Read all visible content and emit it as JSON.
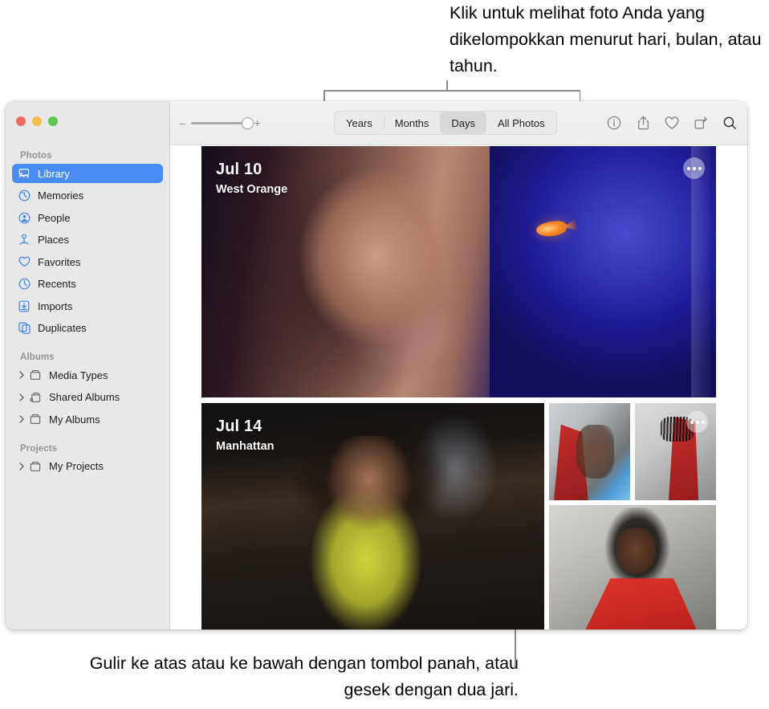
{
  "callouts": {
    "top": "Klik untuk melihat foto Anda yang dikelompokkan menurut hari, bulan, atau tahun.",
    "bottom": "Gulir ke atas atau ke bawah dengan tombol panah, atau gesek dengan dua jari."
  },
  "window": {
    "traffic_lights": {
      "close": "close-button",
      "minimize": "minimize-button",
      "zoom": "zoom-button"
    }
  },
  "sidebar": {
    "sections": [
      {
        "title": "Photos",
        "items": [
          {
            "label": "Library",
            "icon": "library-icon",
            "selected": true,
            "group": false
          },
          {
            "label": "Memories",
            "icon": "memories-icon",
            "selected": false,
            "group": false
          },
          {
            "label": "People",
            "icon": "people-icon",
            "selected": false,
            "group": false
          },
          {
            "label": "Places",
            "icon": "places-icon",
            "selected": false,
            "group": false
          },
          {
            "label": "Favorites",
            "icon": "heart-icon",
            "selected": false,
            "group": false
          },
          {
            "label": "Recents",
            "icon": "clock-icon",
            "selected": false,
            "group": false
          },
          {
            "label": "Imports",
            "icon": "import-icon",
            "selected": false,
            "group": false
          },
          {
            "label": "Duplicates",
            "icon": "duplicates-icon",
            "selected": false,
            "group": false
          }
        ]
      },
      {
        "title": "Albums",
        "items": [
          {
            "label": "Media Types",
            "icon": "album-icon",
            "selected": false,
            "group": true
          },
          {
            "label": "Shared Albums",
            "icon": "shared-album-icon",
            "selected": false,
            "group": true
          },
          {
            "label": "My Albums",
            "icon": "album-icon",
            "selected": false,
            "group": true
          }
        ]
      },
      {
        "title": "Projects",
        "items": [
          {
            "label": "My Projects",
            "icon": "album-icon",
            "selected": false,
            "group": true
          }
        ]
      }
    ]
  },
  "toolbar": {
    "zoom_slider": {
      "decrease_label": "–",
      "increase_label": "+",
      "value": 100
    },
    "segmented": {
      "options": [
        "Years",
        "Months",
        "Days",
        "All Photos"
      ],
      "selected": "Days"
    },
    "icons": [
      {
        "name": "info-icon",
        "label": "Info"
      },
      {
        "name": "share-icon",
        "label": "Share"
      },
      {
        "name": "favorite-icon",
        "label": "Favorite"
      },
      {
        "name": "rotate-icon",
        "label": "Rotate"
      },
      {
        "name": "search-icon",
        "label": "Search"
      }
    ]
  },
  "library": {
    "days": [
      {
        "date": "Jul 10",
        "place": "West Orange",
        "more_button": "more-options-button"
      },
      {
        "date": "Jul 14",
        "place": "Manhattan",
        "more_button": "more-options-button"
      }
    ]
  },
  "colors": {
    "accent": "#4a8cf7",
    "sidebar_bg": "#e9e8e8",
    "toolbar_bg": "#f1f0f0",
    "segment_selected": "#d9d7d7",
    "icon_blue": "#3b82f6",
    "traffic_red": "#ed6a5e",
    "traffic_yellow": "#f4bd4f",
    "traffic_green": "#61c554"
  }
}
